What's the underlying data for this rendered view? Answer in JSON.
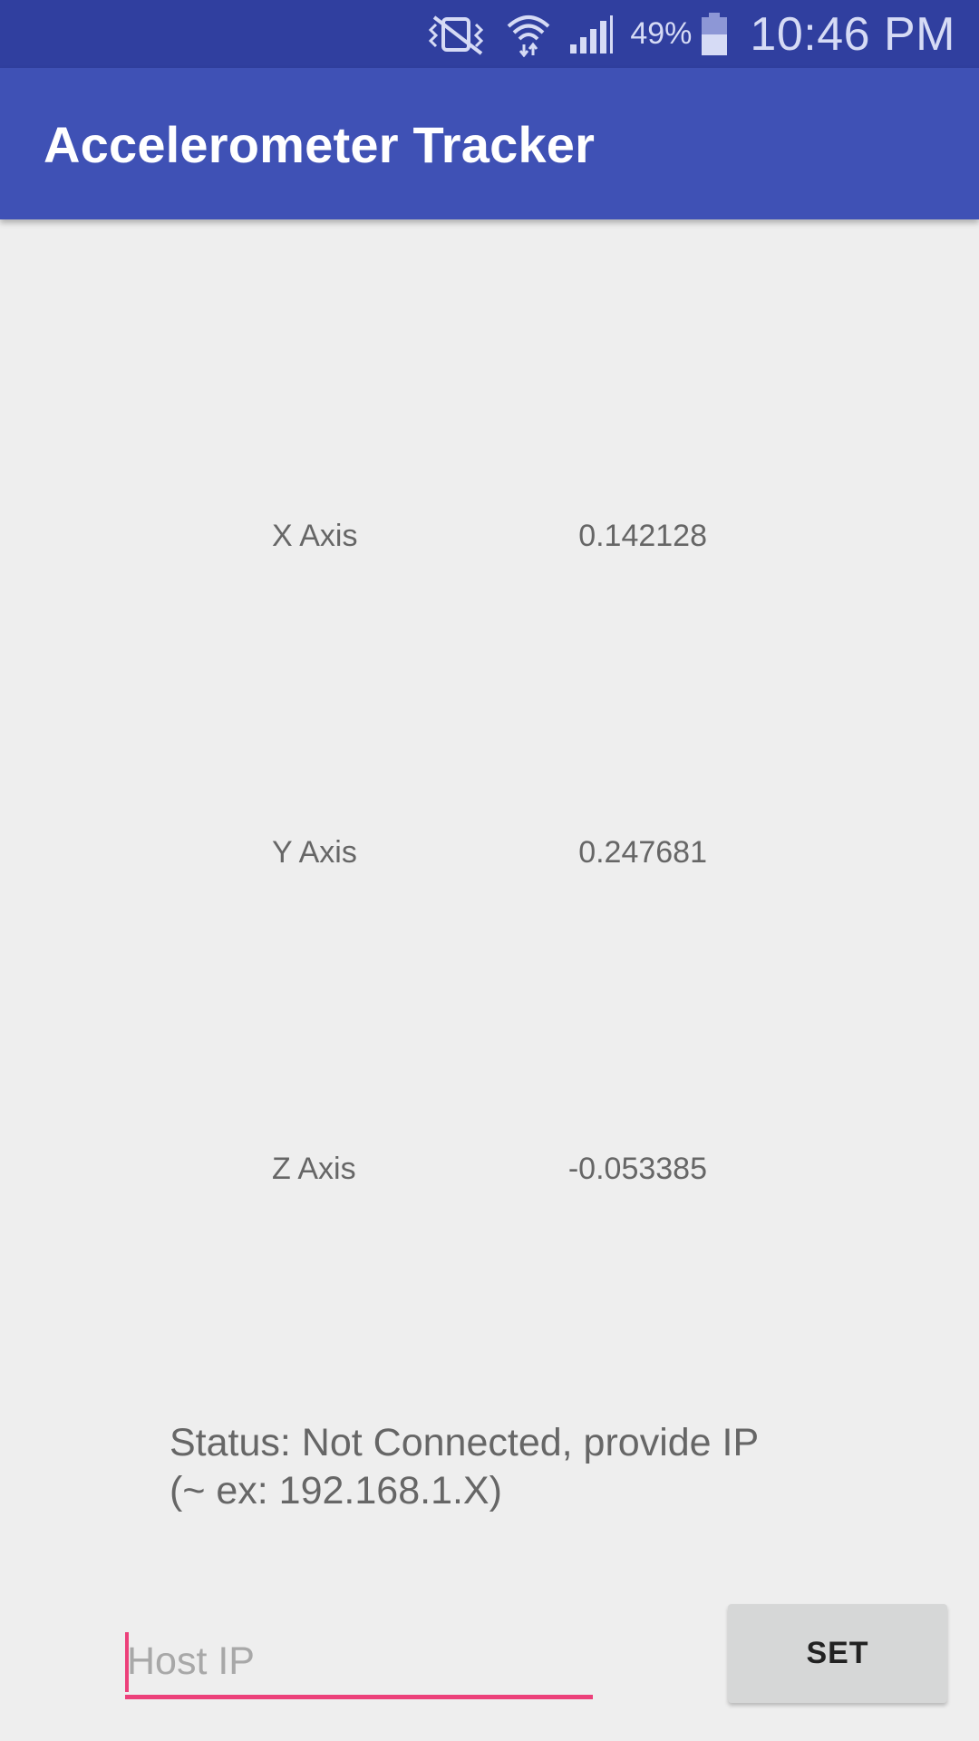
{
  "status_bar": {
    "icons": [
      "vibrate-mute-icon",
      "wifi-icon",
      "signal-icon",
      "battery-icon"
    ],
    "battery_percent": "49%",
    "time": "10:46 PM",
    "background_color": "#303f9f"
  },
  "app_bar": {
    "title": "Accelerometer Tracker",
    "background_color": "#3f51b5"
  },
  "axes": [
    {
      "label": "X Axis",
      "value": "0.142128"
    },
    {
      "label": "Y Axis",
      "value": "0.247681"
    },
    {
      "label": "Z Axis",
      "value": "-0.053385"
    }
  ],
  "status": {
    "line1": "Status: Not Connected, provide IP",
    "line2": "(~ ex: 192.168.1.X)"
  },
  "host_input": {
    "placeholder": "Host IP",
    "value": "",
    "accent_color": "#ec407a"
  },
  "set_button": {
    "label": "SET"
  }
}
